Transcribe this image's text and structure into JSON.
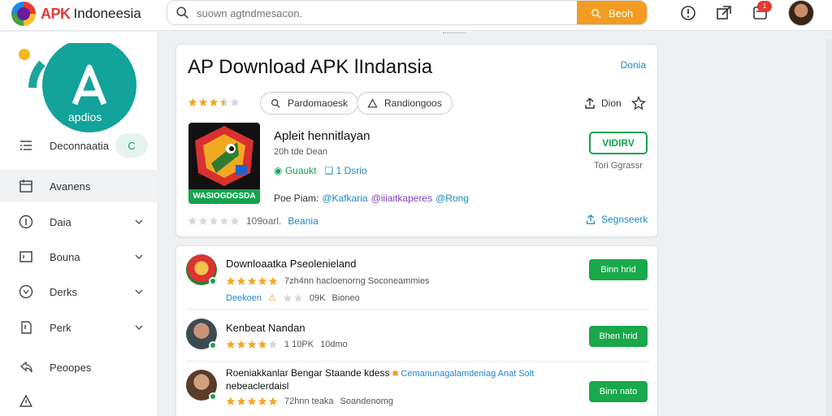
{
  "header": {
    "brand_apk": "APK",
    "brand_name": "Indoneesia",
    "search_placeholder": "suown agtndmesacon.",
    "search_button": "Beoh",
    "notification_count": "1",
    "icons": [
      "search-icon",
      "info-icon",
      "external-window-icon",
      "notification-icon"
    ]
  },
  "sidebar": {
    "logo_text": "apdios",
    "items": [
      {
        "label": "Deconnaatia",
        "icon": "list-icon",
        "toggle": "C"
      },
      {
        "label": "Avanens",
        "icon": "calendar-icon"
      },
      {
        "label": "Daia",
        "icon": "number-icon"
      },
      {
        "label": "Bouna",
        "icon": "window-icon"
      },
      {
        "label": "Derks",
        "icon": "circle-icon"
      },
      {
        "label": "Perk",
        "icon": "page-icon"
      },
      {
        "label": "Peoopes",
        "icon": "share-icon"
      },
      {
        "label": "",
        "icon": "warning-icon"
      }
    ]
  },
  "featured": {
    "title": "AP Download APK lIndansia",
    "top_link": "Donia",
    "rating": 3.5,
    "pills": [
      "Pardomaoesk",
      "Randiongoos"
    ],
    "action_label": "Dion",
    "app_name": "Apleit hennitlayan",
    "app_sub": "20h tde Dean",
    "meta_green": "Guaukt",
    "meta_blue": "1 Dsrio",
    "tags_prefix": "Poe Piam:",
    "tags": [
      "@Kafkaria",
      "@iiiaitkaperes",
      "@Rong"
    ],
    "icon_strip": "WASIOGDGSDA",
    "rating_count": "109oarl.",
    "rating_link": "Beania",
    "cta_label": "VIDIRV",
    "cta_note": "Tori Ggrassr",
    "share_label": "Segnseerk",
    "accent": "#1e88c8",
    "green": "#14a44d"
  },
  "list": [
    {
      "title": "Downloaatka Pseolenieland",
      "rating": 5,
      "rating_text": "7zh4nn hacloenorng Soconeammies",
      "extra_link": "Deekoen",
      "extra_count": "09K",
      "extra_text": "Bioneo",
      "button": "Binn hrid"
    },
    {
      "title": "Kenbeat Nandan",
      "rating": 4,
      "rating_text": "",
      "extra_link": "",
      "extra_count": "1 10PK",
      "extra_text": "10dmo",
      "button": "Bhen hrid"
    },
    {
      "title": "Roeniakkanlar Bengar Staande kdess",
      "title_cont": "nebeaclerdaisl",
      "link": "Cemanunagalamdeniag Anat Solt",
      "rating": 5,
      "rating_text": "72hnn teaka",
      "extra_text": "Soandenomg",
      "button": "Binn nato"
    }
  ]
}
